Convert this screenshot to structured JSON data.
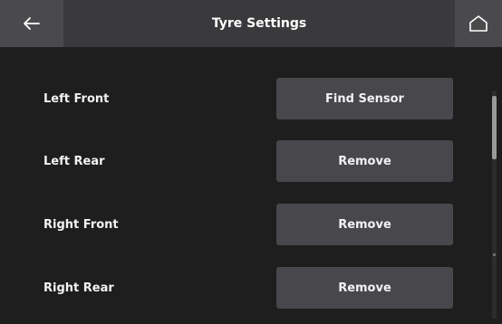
{
  "header": {
    "title": "Tyre Settings",
    "back_icon": "arrow-left-icon",
    "home_icon": "home-icon"
  },
  "sensors": [
    {
      "label": "Left Front",
      "button": "Find Sensor"
    },
    {
      "label": "Left Rear",
      "button": "Remove"
    },
    {
      "label": "Right Front",
      "button": "Remove"
    },
    {
      "label": "Right Rear",
      "button": "Remove"
    }
  ],
  "colors": {
    "background": "#1e1e1e",
    "header": "#3a3a3d",
    "button": "#48484c",
    "text": "#f2f2f2"
  }
}
